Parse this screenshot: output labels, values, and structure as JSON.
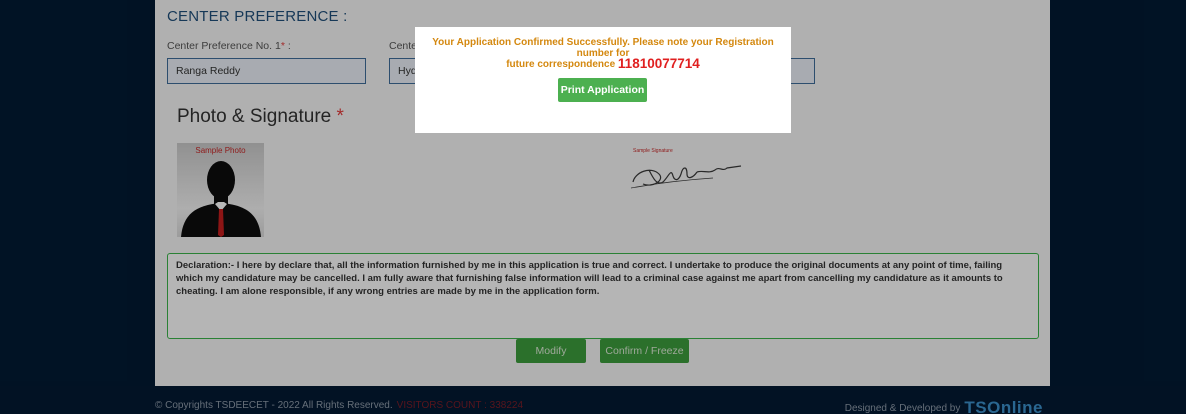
{
  "center": {
    "title": "CENTER PREFERENCE :",
    "pref1_label": "Center Preference No. 1",
    "pref1_req": "*",
    "pref1_colon": " :",
    "pref1_value": "Ranga Reddy",
    "pref2_label_partial": "Cente",
    "pref2_value_partial": "Hyd"
  },
  "photo": {
    "heading": "Photo & Signature",
    "req": "*",
    "sample_photo_caption": "Sample Photo",
    "sample_signature_caption": "Sample Signature"
  },
  "declaration": {
    "text": "Declaration:- I here by declare that, all the information furnished by me in this application is true and correct. I undertake to produce the original documents at any point of time, failing which my candidature may be cancelled. I am fully aware that furnishing false information will lead to a criminal case against me apart from cancelling my candidature as it amounts to cheating. I am alone responsible, if any wrong entries are made by me in the application form."
  },
  "actions": {
    "modify_label": "Modify",
    "confirm_label": "Confirm / Freeze"
  },
  "modal": {
    "line1": "Your Application Confirmed Successfully. Please note your Registration number for",
    "line2": "future correspondence",
    "registration_number": "11810077714",
    "print_label": "Print Application"
  },
  "footer": {
    "copyright": "© Copyrights TSDEECET - 2022 All Rights Reserved.",
    "visitor": "VISITORS COUNT : 338224",
    "designed_by": "Designed & Developed by",
    "logo_text": "TSOnline"
  },
  "colors": {
    "page_bg": "#021a33",
    "accent_green": "#4cb050",
    "message_orange": "#d4880f",
    "registration_red": "#e02020"
  }
}
